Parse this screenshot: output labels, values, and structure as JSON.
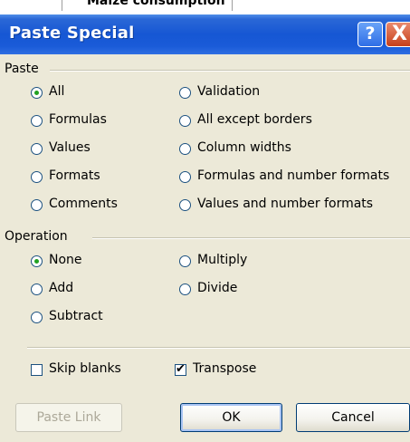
{
  "background_text": "Maize consumption",
  "dialog": {
    "title": "Paste Special",
    "help_label": "?",
    "close_label": "X"
  },
  "paste": {
    "label": "Paste",
    "selected": "All",
    "options": {
      "all": "All",
      "formulas": "Formulas",
      "values": "Values",
      "formats": "Formats",
      "comments": "Comments",
      "validation": "Validation",
      "all_except_borders": "All except borders",
      "column_widths": "Column widths",
      "formulas_number_formats": "Formulas and number formats",
      "values_number_formats": "Values and number formats"
    }
  },
  "operation": {
    "label": "Operation",
    "selected": "None",
    "options": {
      "none": "None",
      "add": "Add",
      "subtract": "Subtract",
      "multiply": "Multiply",
      "divide": "Divide"
    }
  },
  "checkboxes": {
    "skip_blanks": {
      "label": "Skip blanks",
      "checked": false
    },
    "transpose": {
      "label": "Transpose",
      "checked": true
    }
  },
  "buttons": {
    "paste_link": "Paste Link",
    "ok": "OK",
    "cancel": "Cancel"
  },
  "colors": {
    "titlebar": "#1657d4",
    "dialog_bg": "#ece9d8",
    "radio_dot": "#21a121",
    "close_button": "#c8401a"
  }
}
